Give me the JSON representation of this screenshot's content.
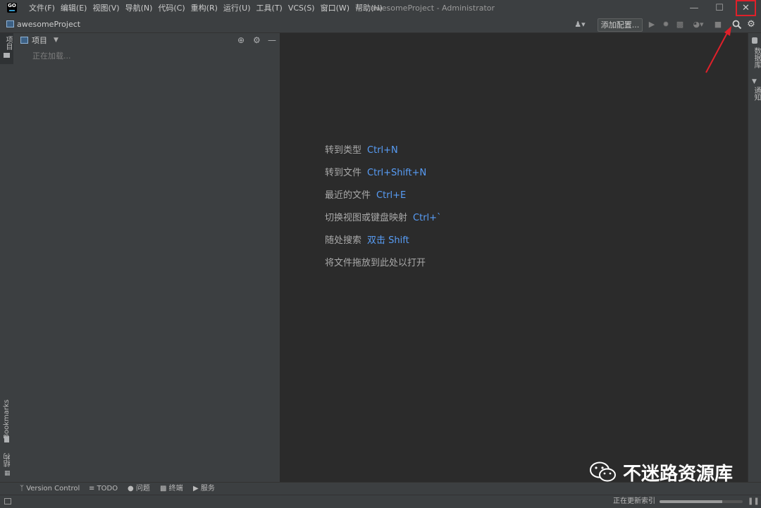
{
  "app": {
    "logo_text": "GO",
    "window_title": "awesomeProject - Administrator"
  },
  "menu": [
    "文件(F)",
    "编辑(E)",
    "视图(V)",
    "导航(N)",
    "代码(C)",
    "重构(R)",
    "运行(U)",
    "工具(T)",
    "VCS(S)",
    "窗口(W)",
    "帮助(H)"
  ],
  "window_controls": {
    "minimize": "—",
    "maximize": "☐",
    "close": "✕"
  },
  "navbar": {
    "breadcrumb": "awesomeProject",
    "add_config": "添加配置..."
  },
  "left_strip": {
    "project": "项目",
    "bookmarks": "Bookmarks",
    "structure": "结构"
  },
  "right_strip": {
    "database": "数据库",
    "notifications": "通知"
  },
  "project_panel": {
    "title": "项目",
    "loading": "正在加载..."
  },
  "editor_hints": [
    {
      "label": "转到类型",
      "key": "Ctrl+N"
    },
    {
      "label": "转到文件",
      "key": "Ctrl+Shift+N"
    },
    {
      "label": "最近的文件",
      "key": "Ctrl+E"
    },
    {
      "label": "切换视图或键盘映射",
      "key": "Ctrl+`"
    },
    {
      "label": "随处搜索",
      "key": "双击 Shift"
    },
    {
      "label": "将文件拖放到此处以打开",
      "key": ""
    }
  ],
  "tool_windows": [
    "Version Control",
    "TODO",
    "问题",
    "终端",
    "服务"
  ],
  "status": {
    "text": "正在更新索引",
    "progress": 0.75
  },
  "watermark": {
    "text": "不迷路资源库"
  },
  "colors": {
    "accent": "#589df6",
    "highlight": "#e0202a"
  }
}
